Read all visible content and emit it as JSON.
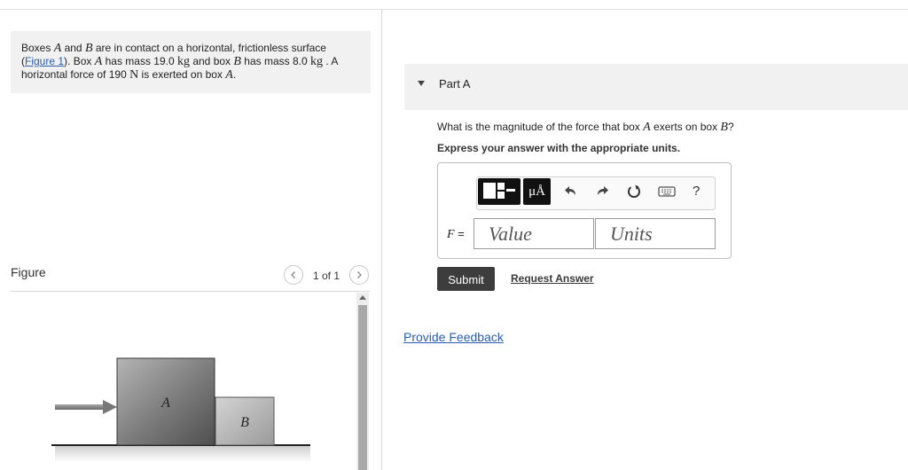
{
  "problem": {
    "t1": "Boxes ",
    "boxA": "A",
    "t2": " and ",
    "boxB": "B",
    "t3": " are in contact on a horizontal, frictionless surface",
    "figure_link": "Figure 1",
    "t4_open": "(",
    "t5": "). Box ",
    "boxA2": "A",
    "t6": " has mass 19.0 ",
    "unit_kg": "kg",
    "t7": " and box ",
    "boxB2": "B",
    "t8": " has mass 8.0 ",
    "unit_kg2": "kg",
    "t9": " . A",
    "t10": "horizontal force of 190 ",
    "unit_N": "N",
    "t11": " is exerted on box ",
    "boxA3": "A",
    "t12": "."
  },
  "figure": {
    "title": "Figure",
    "pager": "1 of 1",
    "label_a": "A",
    "label_b": "B"
  },
  "part": {
    "label": "Part A",
    "question_pre": "What is the magnitude of the force that box ",
    "question_a": "A",
    "question_mid": " exerts on box ",
    "question_b": "B",
    "question_end": "?",
    "instruction": "Express your answer with the appropriate units."
  },
  "toolbar": {
    "units_label": "μÅ",
    "help_label": "?"
  },
  "answer": {
    "var": "F",
    "eq": " =",
    "value_placeholder": "Value",
    "units_placeholder": "Units"
  },
  "actions": {
    "submit": "Submit",
    "request": "Request Answer",
    "feedback": "Provide Feedback"
  }
}
